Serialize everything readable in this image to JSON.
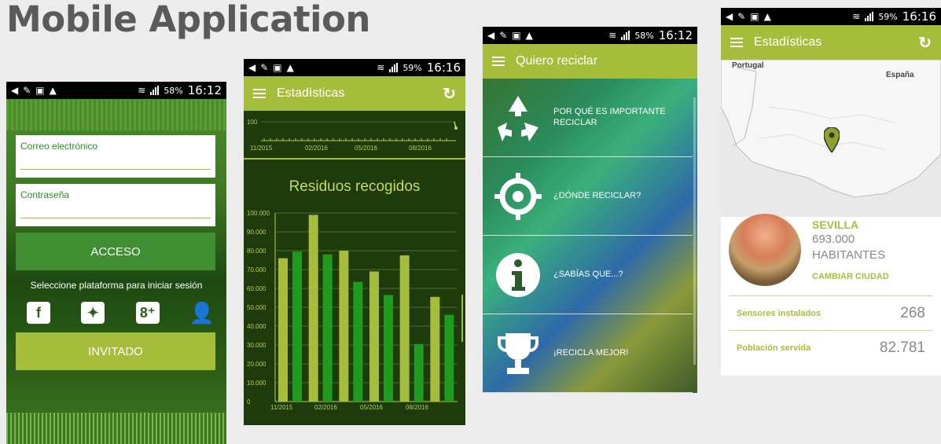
{
  "heading": "Mobile Application",
  "colors": {
    "accent": "#a6bd3b",
    "dark_green": "#1e3b0c",
    "bar_light": "#a6bd3b",
    "bar_dark": "#1f9a1f"
  },
  "status_times": [
    "16:12",
    "16:16",
    "16:12",
    "16:16"
  ],
  "status_battery": [
    "58%",
    "59%",
    "58%",
    "59%"
  ],
  "login": {
    "email_label": "Correo electrónico",
    "password_label": "Contraseña",
    "access_button": "ACCESO",
    "platform_prompt": "Seleccione plataforma para iniciar sesión",
    "social_icons": [
      "facebook-icon",
      "twitter-icon",
      "google-plus-icon",
      "add-user-icon"
    ],
    "guest_button": "INVITADO"
  },
  "stats": {
    "appbar_title": "Estadísticas",
    "mini_chart": {
      "y_label": "100",
      "x_labels": [
        "11/2015",
        "02/2016",
        "05/2016",
        "08/2016"
      ]
    },
    "chart_title": "Residuos recogidos"
  },
  "chart_data": {
    "type": "bar",
    "title": "Residuos recogidos",
    "ylim": [
      0,
      100000
    ],
    "y_ticks": [
      "0",
      "10.000",
      "20.000",
      "30.000",
      "40.000",
      "50.000",
      "60.000",
      "70.000",
      "80.000",
      "90.000",
      "100.000"
    ],
    "x_labels": [
      "11/2015",
      "02/2016",
      "05/2016",
      "08/2016"
    ],
    "series": [
      {
        "color": "#a6bd3b",
        "values": [
          76000,
          99000,
          80000,
          69000,
          77500,
          55500
        ]
      },
      {
        "color": "#1f9a1f",
        "values": [
          79500,
          78000,
          63500,
          56500,
          30500,
          46000
        ]
      }
    ]
  },
  "recycle": {
    "appbar_title": "Quiero reciclar",
    "items": [
      {
        "icon": "recycle-icon",
        "label": "POR QUÉ ES IMPORTANTE RECICLAR"
      },
      {
        "icon": "target-icon",
        "label": "¿DÓNDE RECICLAR?"
      },
      {
        "icon": "info-icon",
        "label": "¿SABÍAS QUE...?"
      },
      {
        "icon": "trophy-icon",
        "label": "¡RECICLA MEJOR!"
      }
    ]
  },
  "city": {
    "appbar_title": "Estadísticas",
    "map_labels": {
      "portugal": "Portugal",
      "espana": "España"
    },
    "name": "SEVILLA",
    "population": "693.000",
    "inhabitants_label": "HABITANTES",
    "change_city": "CAMBIAR CIUDAD",
    "rows": [
      {
        "label": "Sensores instalados",
        "value": "268"
      },
      {
        "label": "Población servida",
        "value": "82.781"
      }
    ]
  }
}
